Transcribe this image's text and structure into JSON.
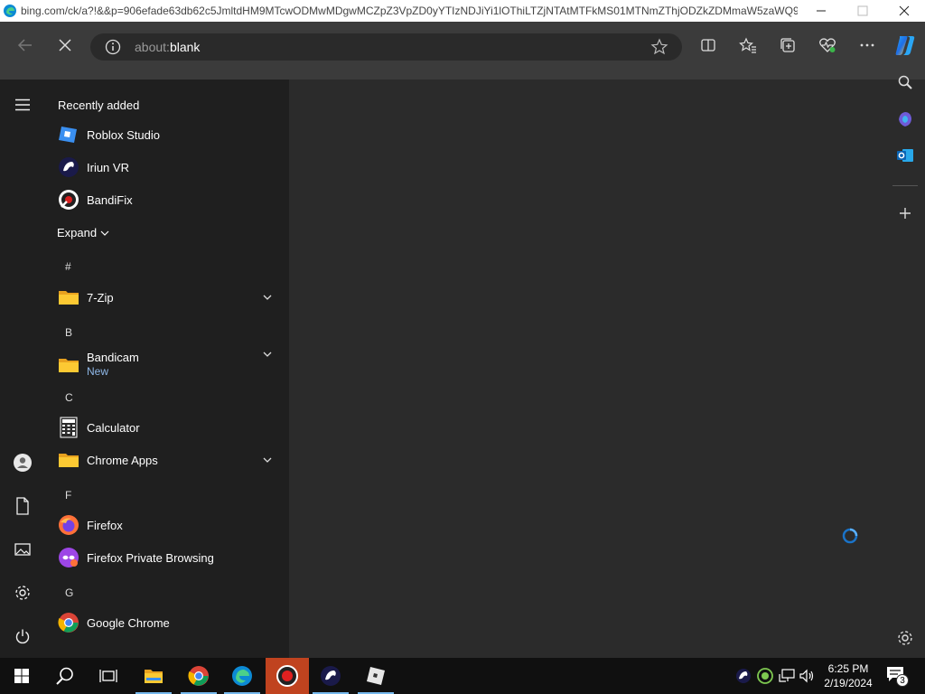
{
  "browser": {
    "tab_url": "bing.com/ck/a?!&&p=906efade63db62c5JmltdHM9MTcwODMwMDgwMCZpZ3VpZD0yYTIzNDJiYi1lOThiLTZjNTAtMTFkMS01MTNmZThjODZkZDMmaW5zaWQ9...",
    "address": {
      "scheme": "about:",
      "host": "blank"
    },
    "icons": {
      "back": "back-arrow-icon",
      "stop": "close-icon",
      "info": "info-icon",
      "favorite": "star-icon",
      "split": "split-screen-icon",
      "favorites": "favorites-icon",
      "collections": "collections-icon",
      "health": "browser-essentials-icon",
      "more": "more-icon",
      "copilot": "copilot-icon"
    }
  },
  "window": {
    "minimize": "minimize-icon",
    "maximize": "maximize-icon",
    "close": "close-icon"
  },
  "edge_sidebar": {
    "icons": [
      "search-icon",
      "copilot-icon",
      "outlook-icon",
      "add-icon",
      "settings-icon"
    ]
  },
  "start_menu": {
    "recently_added_label": "Recently added",
    "recent": [
      {
        "label": "Roblox Studio"
      },
      {
        "label": "Iriun VR"
      },
      {
        "label": "BandiFix"
      }
    ],
    "expand_label": "Expand",
    "groups": [
      {
        "letter": "#",
        "apps": [
          {
            "label": "7-Zip",
            "folder": true
          }
        ]
      },
      {
        "letter": "B",
        "apps": [
          {
            "label": "Bandicam",
            "folder": true,
            "badge": "New"
          }
        ]
      },
      {
        "letter": "C",
        "apps": [
          {
            "label": "Calculator"
          },
          {
            "label": "Chrome Apps",
            "folder": true
          }
        ]
      },
      {
        "letter": "F",
        "apps": [
          {
            "label": "Firefox"
          },
          {
            "label": "Firefox Private Browsing"
          }
        ]
      },
      {
        "letter": "G",
        "apps": [
          {
            "label": "Google Chrome"
          }
        ]
      }
    ],
    "rail_icons": [
      "hamburger-menu-icon",
      "user-icon",
      "documents-icon",
      "pictures-icon",
      "settings-icon",
      "power-icon"
    ]
  },
  "taskbar": {
    "clock_time": "6:25 PM",
    "clock_date": "2/19/2024",
    "notification_count": "3",
    "apps": [
      "start-icon",
      "search-icon",
      "task-view-icon",
      "file-explorer-icon",
      "chrome-icon",
      "edge-icon",
      "bandicam-icon",
      "iriun-icon",
      "roblox-icon"
    ],
    "accent_active": "#c0431f"
  },
  "colors": {
    "toolbar_bg": "#3b3b3b",
    "content_bg": "#2b2b2b",
    "start_bg": "#1f1f1f",
    "taskbar_bg": "#101010",
    "new_badge": "#8fb8e8"
  }
}
